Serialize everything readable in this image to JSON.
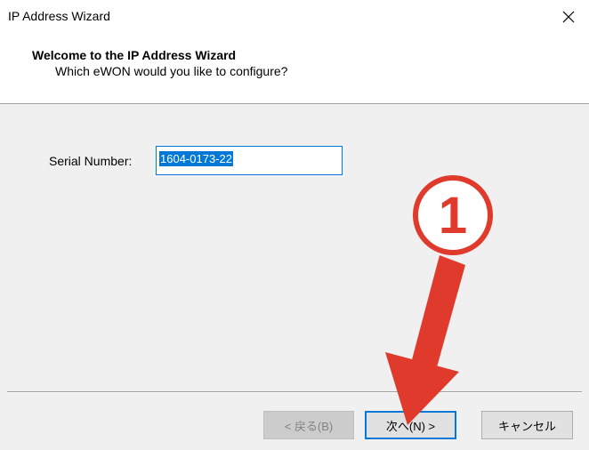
{
  "window": {
    "title": "IP Address Wizard",
    "close_glyph": "×"
  },
  "header": {
    "title": "Welcome to the IP Address Wizard",
    "subtitle": "Which eWON would you like to configure?"
  },
  "form": {
    "serial_label": "Serial Number:",
    "serial_value": "1604-0173-22"
  },
  "buttons": {
    "back_label": "< 戻る(B)",
    "next_label": "次へ(N) >",
    "cancel_label": "キャンセル"
  },
  "annotation": {
    "step_number": "1",
    "arrow_color": "#e03a2c",
    "marker_color": "#e03a2c"
  },
  "colors": {
    "accent": "#0078d7",
    "panel": "#f0f0f0"
  }
}
